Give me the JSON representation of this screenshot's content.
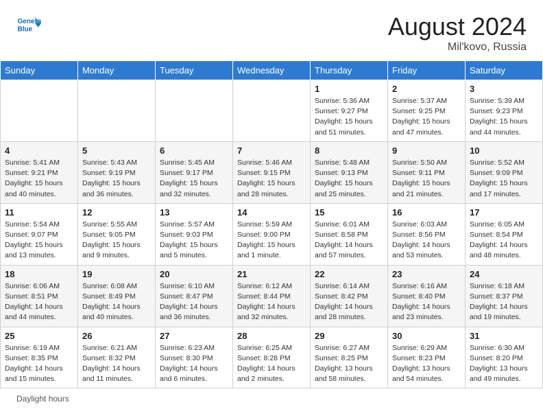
{
  "header": {
    "logo_line1": "General",
    "logo_line2": "Blue",
    "month_year": "August 2024",
    "location": "Mil'kovo, Russia"
  },
  "days_of_week": [
    "Sunday",
    "Monday",
    "Tuesday",
    "Wednesday",
    "Thursday",
    "Friday",
    "Saturday"
  ],
  "weeks": [
    [
      {
        "day": "",
        "info": ""
      },
      {
        "day": "",
        "info": ""
      },
      {
        "day": "",
        "info": ""
      },
      {
        "day": "",
        "info": ""
      },
      {
        "day": "1",
        "info": "Sunrise: 5:36 AM\nSunset: 9:27 PM\nDaylight: 15 hours\nand 51 minutes."
      },
      {
        "day": "2",
        "info": "Sunrise: 5:37 AM\nSunset: 9:25 PM\nDaylight: 15 hours\nand 47 minutes."
      },
      {
        "day": "3",
        "info": "Sunrise: 5:39 AM\nSunset: 9:23 PM\nDaylight: 15 hours\nand 44 minutes."
      }
    ],
    [
      {
        "day": "4",
        "info": "Sunrise: 5:41 AM\nSunset: 9:21 PM\nDaylight: 15 hours\nand 40 minutes."
      },
      {
        "day": "5",
        "info": "Sunrise: 5:43 AM\nSunset: 9:19 PM\nDaylight: 15 hours\nand 36 minutes."
      },
      {
        "day": "6",
        "info": "Sunrise: 5:45 AM\nSunset: 9:17 PM\nDaylight: 15 hours\nand 32 minutes."
      },
      {
        "day": "7",
        "info": "Sunrise: 5:46 AM\nSunset: 9:15 PM\nDaylight: 15 hours\nand 28 minutes."
      },
      {
        "day": "8",
        "info": "Sunrise: 5:48 AM\nSunset: 9:13 PM\nDaylight: 15 hours\nand 25 minutes."
      },
      {
        "day": "9",
        "info": "Sunrise: 5:50 AM\nSunset: 9:11 PM\nDaylight: 15 hours\nand 21 minutes."
      },
      {
        "day": "10",
        "info": "Sunrise: 5:52 AM\nSunset: 9:09 PM\nDaylight: 15 hours\nand 17 minutes."
      }
    ],
    [
      {
        "day": "11",
        "info": "Sunrise: 5:54 AM\nSunset: 9:07 PM\nDaylight: 15 hours\nand 13 minutes."
      },
      {
        "day": "12",
        "info": "Sunrise: 5:55 AM\nSunset: 9:05 PM\nDaylight: 15 hours\nand 9 minutes."
      },
      {
        "day": "13",
        "info": "Sunrise: 5:57 AM\nSunset: 9:03 PM\nDaylight: 15 hours\nand 5 minutes."
      },
      {
        "day": "14",
        "info": "Sunrise: 5:59 AM\nSunset: 9:00 PM\nDaylight: 15 hours\nand 1 minute."
      },
      {
        "day": "15",
        "info": "Sunrise: 6:01 AM\nSunset: 8:58 PM\nDaylight: 14 hours\nand 57 minutes."
      },
      {
        "day": "16",
        "info": "Sunrise: 6:03 AM\nSunset: 8:56 PM\nDaylight: 14 hours\nand 53 minutes."
      },
      {
        "day": "17",
        "info": "Sunrise: 6:05 AM\nSunset: 8:54 PM\nDaylight: 14 hours\nand 48 minutes."
      }
    ],
    [
      {
        "day": "18",
        "info": "Sunrise: 6:06 AM\nSunset: 8:51 PM\nDaylight: 14 hours\nand 44 minutes."
      },
      {
        "day": "19",
        "info": "Sunrise: 6:08 AM\nSunset: 8:49 PM\nDaylight: 14 hours\nand 40 minutes."
      },
      {
        "day": "20",
        "info": "Sunrise: 6:10 AM\nSunset: 8:47 PM\nDaylight: 14 hours\nand 36 minutes."
      },
      {
        "day": "21",
        "info": "Sunrise: 6:12 AM\nSunset: 8:44 PM\nDaylight: 14 hours\nand 32 minutes."
      },
      {
        "day": "22",
        "info": "Sunrise: 6:14 AM\nSunset: 8:42 PM\nDaylight: 14 hours\nand 28 minutes."
      },
      {
        "day": "23",
        "info": "Sunrise: 6:16 AM\nSunset: 8:40 PM\nDaylight: 14 hours\nand 23 minutes."
      },
      {
        "day": "24",
        "info": "Sunrise: 6:18 AM\nSunset: 8:37 PM\nDaylight: 14 hours\nand 19 minutes."
      }
    ],
    [
      {
        "day": "25",
        "info": "Sunrise: 6:19 AM\nSunset: 8:35 PM\nDaylight: 14 hours\nand 15 minutes."
      },
      {
        "day": "26",
        "info": "Sunrise: 6:21 AM\nSunset: 8:32 PM\nDaylight: 14 hours\nand 11 minutes."
      },
      {
        "day": "27",
        "info": "Sunrise: 6:23 AM\nSunset: 8:30 PM\nDaylight: 14 hours\nand 6 minutes."
      },
      {
        "day": "28",
        "info": "Sunrise: 6:25 AM\nSunset: 8:28 PM\nDaylight: 14 hours\nand 2 minutes."
      },
      {
        "day": "29",
        "info": "Sunrise: 6:27 AM\nSunset: 8:25 PM\nDaylight: 13 hours\nand 58 minutes."
      },
      {
        "day": "30",
        "info": "Sunrise: 6:29 AM\nSunset: 8:23 PM\nDaylight: 13 hours\nand 54 minutes."
      },
      {
        "day": "31",
        "info": "Sunrise: 6:30 AM\nSunset: 8:20 PM\nDaylight: 13 hours\nand 49 minutes."
      }
    ]
  ],
  "footer": {
    "daylight_label": "Daylight hours"
  }
}
